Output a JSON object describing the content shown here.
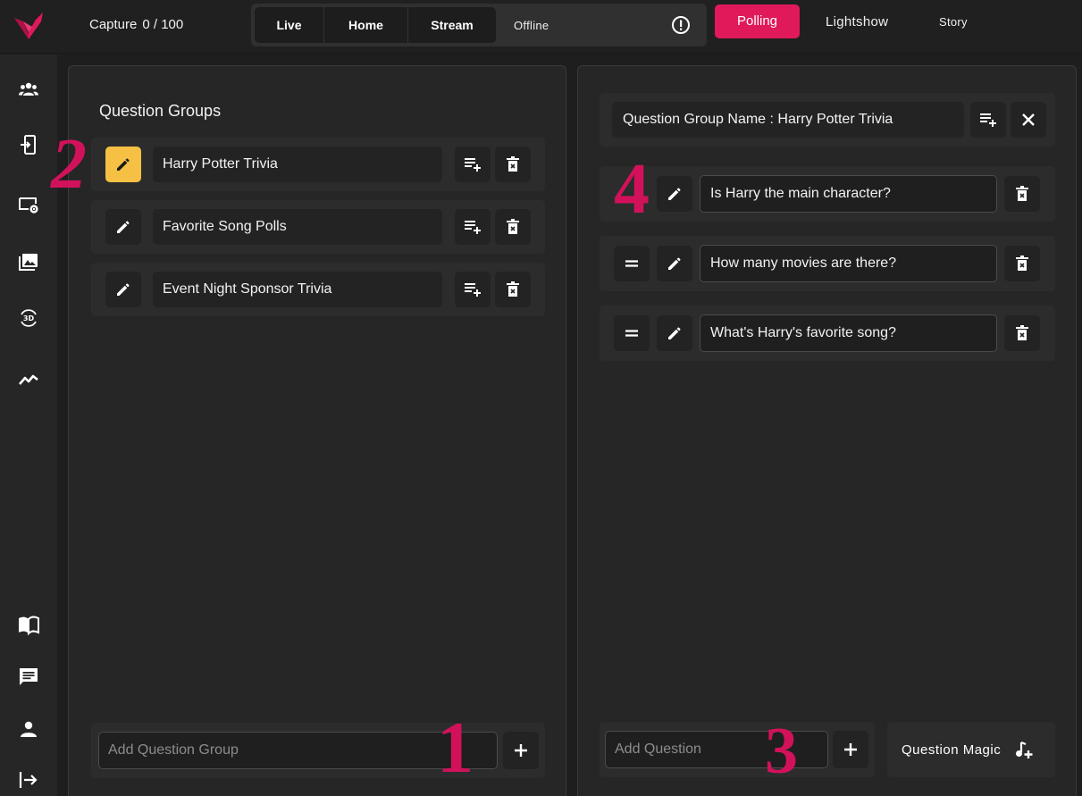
{
  "app": {
    "capture_label": "Capture",
    "capture_count": "0 / 100"
  },
  "modes": {
    "live": "Live",
    "home": "Home",
    "stream": "Stream",
    "status": "Offline"
  },
  "tabs": {
    "polling": "Polling",
    "lightshow": "Lightshow",
    "story": "Story",
    "active": "Polling"
  },
  "colors": {
    "accent": "#e0195a",
    "edit_active": "#f5c043",
    "annotation": "#d1125b"
  },
  "left_panel": {
    "title": "Question Groups",
    "groups": [
      {
        "name": "Harry Potter Trivia",
        "editing": true
      },
      {
        "name": "Favorite Song Polls",
        "editing": false
      },
      {
        "name": "Event Night Sponsor Trivia",
        "editing": false
      }
    ],
    "add_placeholder": "Add Question Group"
  },
  "right_panel": {
    "group_name_label": "Question Group Name : Harry Potter Trivia",
    "questions": [
      {
        "text": "Is Harry the main character?"
      },
      {
        "text": "How many movies are there?"
      },
      {
        "text": "What's Harry's favorite song?"
      }
    ],
    "add_placeholder": "Add Question",
    "magic_label": "Question Magic"
  },
  "annotations": [
    "1",
    "2",
    "3",
    "4"
  ]
}
